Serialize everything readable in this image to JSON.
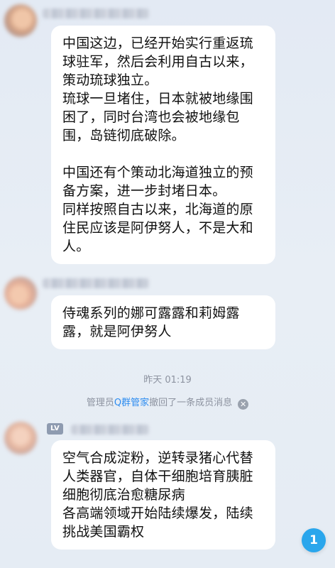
{
  "messages": [
    {
      "text": "中国这边，已经开始实行重返琉球驻军，然后会利用自古以来，策动琉球独立。\n琉球一旦堵住，日本就被地缘围困了，同时台湾也会被地缘包围，岛链彻底破除。\n\n中国还有个策动北海道独立的预备方案，进一步封堵日本。\n同样按照自古以来，北海道的原住民应该是阿伊努人，不是大和人。"
    },
    {
      "text": "侍魂系列的娜可露露和莉姆露露，就是阿伊努人"
    },
    {
      "badge": "LV",
      "text": "空气合成淀粉，逆转录猪心代替人类器官，自体干细胞培育胰脏细胞彻底治愈糖尿病\n各高端领域开始陆续爆发，陆续挑战美国霸权"
    }
  ],
  "timestamp": "昨天 01:19",
  "recall_notice": {
    "prefix": "管理员",
    "link": "Q群管家",
    "suffix": "撤回了一条成员消息",
    "close_icon": "close-icon"
  },
  "unread_count": "1",
  "colors": {
    "background": "#e6edf5",
    "bubble": "#ffffff",
    "link": "#2d8cf0",
    "unread_badge": "#2aa6ec"
  }
}
